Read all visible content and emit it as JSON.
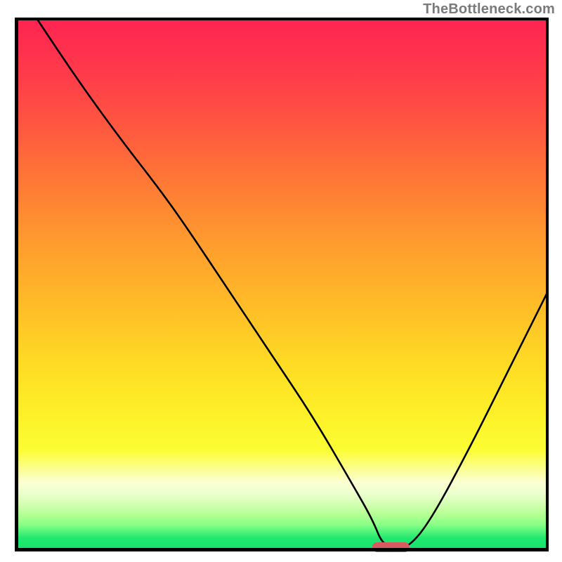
{
  "attribution": "TheBottleneck.com",
  "chart_data": {
    "type": "line",
    "title": "",
    "xlabel": "",
    "ylabel": "",
    "xlim": [
      0,
      100
    ],
    "ylim": [
      0,
      100
    ],
    "grid": false,
    "legend": false,
    "background": "red-green-gradient",
    "series": [
      {
        "name": "bottleneck-curve",
        "x": [
          4,
          12,
          20,
          27,
          32,
          40,
          48,
          56,
          63,
          67,
          69,
          72,
          74,
          78,
          85,
          92,
          100
        ],
        "y": [
          100,
          88,
          77,
          68,
          61,
          49,
          37,
          25,
          13,
          6,
          1,
          1,
          1,
          6,
          19,
          33,
          49
        ]
      }
    ],
    "marker": {
      "name": "optimal-range",
      "x_start": 67,
      "x_end": 74,
      "y": 0.8,
      "color": "#d85a61"
    }
  }
}
